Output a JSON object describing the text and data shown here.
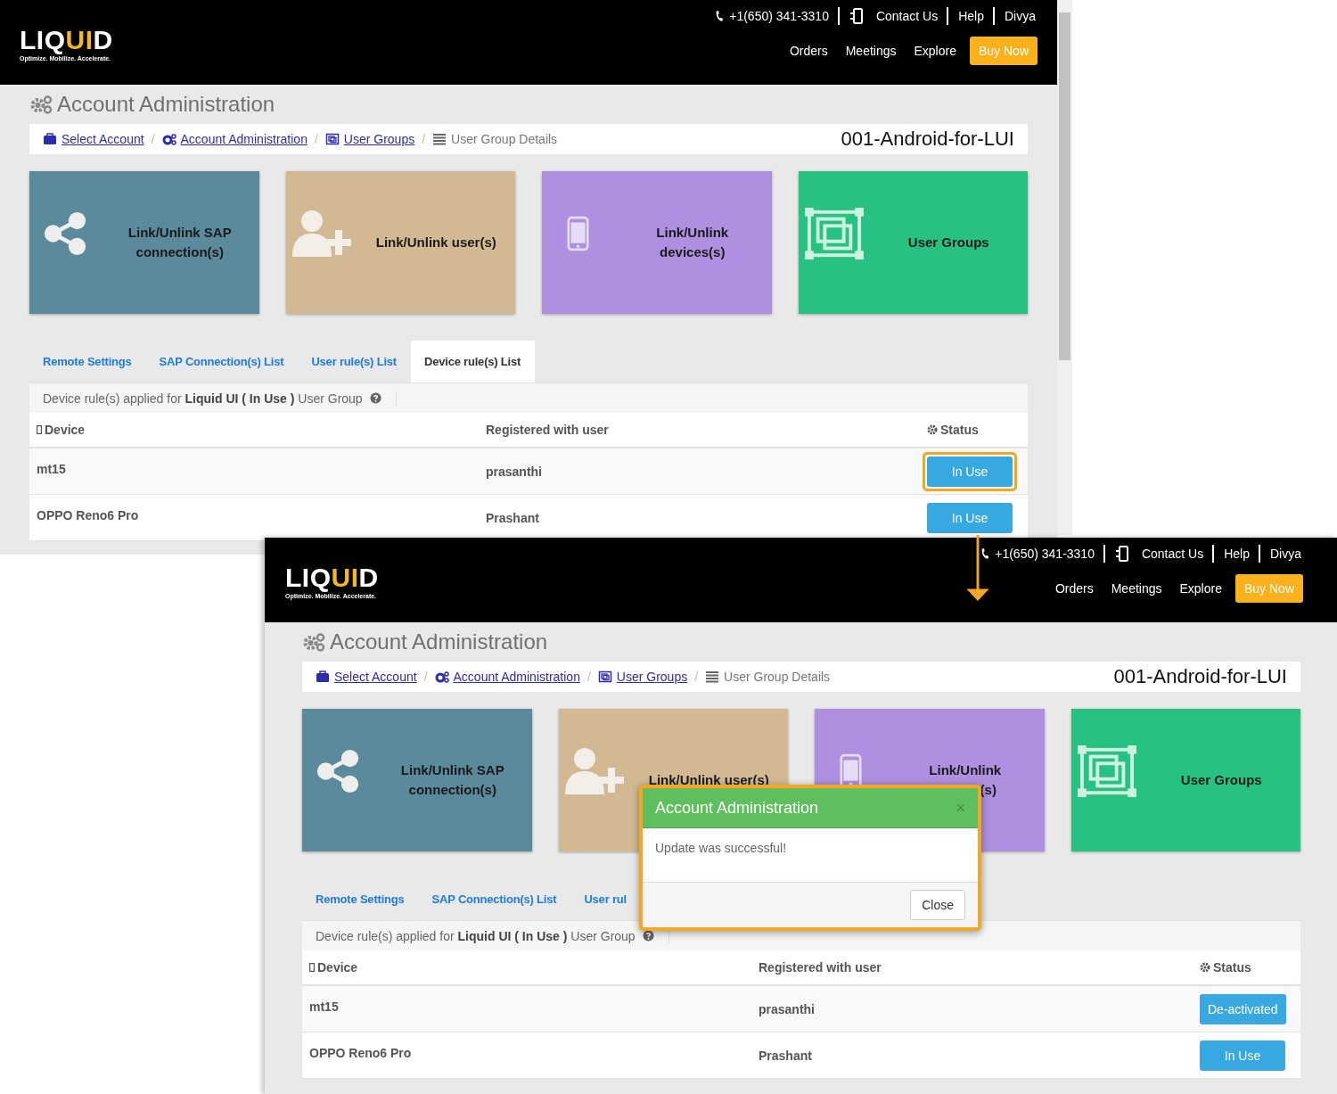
{
  "screens": [
    {
      "header": {
        "logo": [
          {
            "text": "LIQ",
            "accent": false
          },
          {
            "text": "UI",
            "accent": true
          },
          {
            "text": "D",
            "accent": false
          }
        ],
        "tagline": "Optimize. Mobilize. Accelerate.",
        "top_links": [
          {
            "label": "+1(650) 341-3310",
            "kind": "phone"
          },
          {
            "label": "Contact Us",
            "kind": "contact"
          },
          {
            "label": "Help",
            "kind": "plain"
          },
          {
            "label": "Divya",
            "kind": "plain"
          }
        ],
        "nav": [
          "Orders",
          "Meetings",
          "Explore"
        ],
        "buy": "Buy Now"
      },
      "title": "Account Administration",
      "breadcrumb": [
        {
          "label": "Select Account",
          "kind": "briefcase"
        },
        {
          "label": "/",
          "kind": "separator"
        },
        {
          "label": "Account Administration",
          "kind": "gears"
        },
        {
          "label": "/",
          "kind": "separator"
        },
        {
          "label": "User Groups",
          "kind": "frame"
        },
        {
          "label": "/",
          "kind": "separator"
        },
        {
          "label": "User Group Details",
          "kind": "current"
        }
      ],
      "group_name": "001-Android-for-LUI",
      "tiles": [
        {
          "lines": [
            "Link/Unlink SAP",
            "connection(s)"
          ],
          "kind": "share",
          "color": "#5b8a9c"
        },
        {
          "lines": [
            "Link/Unlink user(s)"
          ],
          "kind": "user-add",
          "color": "#d2b994"
        },
        {
          "lines": [
            "Link/Unlink",
            "devices(s)"
          ],
          "kind": "mobile",
          "color": "#ae8fe0"
        },
        {
          "lines": [
            "User Groups"
          ],
          "kind": "frame",
          "color": "#27c281"
        }
      ],
      "tabs": [
        {
          "label": "Remote Settings",
          "selected": false
        },
        {
          "label": "SAP Connection(s) List",
          "selected": false
        },
        {
          "label": "User rule(s) List",
          "selected": false
        },
        {
          "label": "Device rule(s) List",
          "selected": true
        }
      ],
      "info": "Device rule(s) applied for **Liquid UI ( In Use )** User Group",
      "columns": [
        "Device",
        "Registered with user",
        "Status"
      ],
      "rows": [
        {
          "device": "mt15",
          "user": "prasanthi",
          "status": "In Use",
          "highlighted": true
        },
        {
          "device": "OPPO Reno6 Pro",
          "user": "Prashant",
          "status": "In Use",
          "highlighted": false
        }
      ]
    },
    {
      "header": {
        "logo": [
          {
            "text": "LIQ",
            "accent": false
          },
          {
            "text": "UI",
            "accent": true
          },
          {
            "text": "D",
            "accent": false
          }
        ],
        "tagline": "Optimize. Mobilize. Accelerate.",
        "top_links": [
          {
            "label": "+1(650) 341-3310",
            "kind": "phone"
          },
          {
            "label": "Contact Us",
            "kind": "contact"
          },
          {
            "label": "Help",
            "kind": "plain"
          },
          {
            "label": "Divya",
            "kind": "plain"
          }
        ],
        "nav": [
          "Orders",
          "Meetings",
          "Explore"
        ],
        "buy": "Buy Now"
      },
      "title": "Account Administration",
      "breadcrumb": [
        {
          "label": "Select Account",
          "kind": "briefcase"
        },
        {
          "label": "/",
          "kind": "separator"
        },
        {
          "label": "Account Administration",
          "kind": "gears"
        },
        {
          "label": "/",
          "kind": "separator"
        },
        {
          "label": "User Groups",
          "kind": "frame"
        },
        {
          "label": "/",
          "kind": "separator"
        },
        {
          "label": "User Group Details",
          "kind": "current"
        }
      ],
      "group_name": "001-Android-for-LUI",
      "tiles": [
        {
          "lines": [
            "Link/Unlink SAP",
            "connection(s)"
          ],
          "kind": "share",
          "color": "#5b8a9c"
        },
        {
          "lines": [
            "Link/Unlink user(s)"
          ],
          "kind": "user-add",
          "color": "#d2b994"
        },
        {
          "lines": [
            "Link/Unlink",
            "(s)"
          ],
          "kind": "mobile",
          "color": "#ae8fe0"
        },
        {
          "lines": [
            "User Groups"
          ],
          "kind": "frame",
          "color": "#27c281"
        }
      ],
      "tabs": [
        {
          "label": "Remote Settings",
          "selected": false
        },
        {
          "label": "SAP Connection(s) List",
          "selected": false
        },
        {
          "label": "User rul",
          "selected": false
        }
      ],
      "info": "Device rule(s) applied for **Liquid UI ( In Use )** User Group",
      "columns": [
        "Device",
        "Registered with user",
        "Status"
      ],
      "rows": [
        {
          "device": "mt15",
          "user": "prasanthi",
          "status": "De-activated",
          "highlighted": false
        },
        {
          "device": "OPPO Reno6 Pro",
          "user": "Prashant",
          "status": "In Use",
          "highlighted": false
        }
      ],
      "modal": {
        "title": "Account Administration",
        "close_glyph": "×",
        "message": "Update was successful!",
        "button": "Close"
      }
    }
  ]
}
